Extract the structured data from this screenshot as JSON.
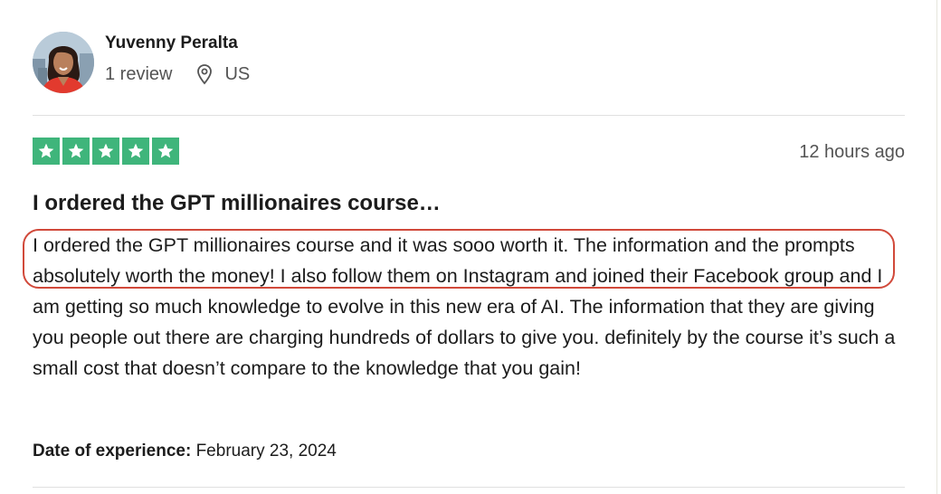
{
  "reviewer": {
    "name": "Yuvenny Peralta",
    "review_count": "1 review",
    "country": "US",
    "location_icon": "map-pin-icon",
    "avatar_icon": "profile-photo"
  },
  "review": {
    "rating": 5,
    "max_rating": 5,
    "star_color": "#3fb57b",
    "time_ago": "12 hours ago",
    "title": "I ordered the GPT millionaires course…",
    "body": "I ordered the GPT millionaires course and it was sooo worth it. The information and the prompts absolutely worth the money! I also follow them on Instagram and joined their Facebook group and I am getting so much knowledge to evolve in this new era of AI. The information that they are giving you people out there are charging hundreds of dollars to give you. definitely by the course it’s such a small cost that doesn’t compare to the knowledge that you gain!",
    "experience_label": "Date of experience:",
    "experience_date": "February 23, 2024"
  },
  "annotation": {
    "highlight_color": "#d1493a"
  }
}
